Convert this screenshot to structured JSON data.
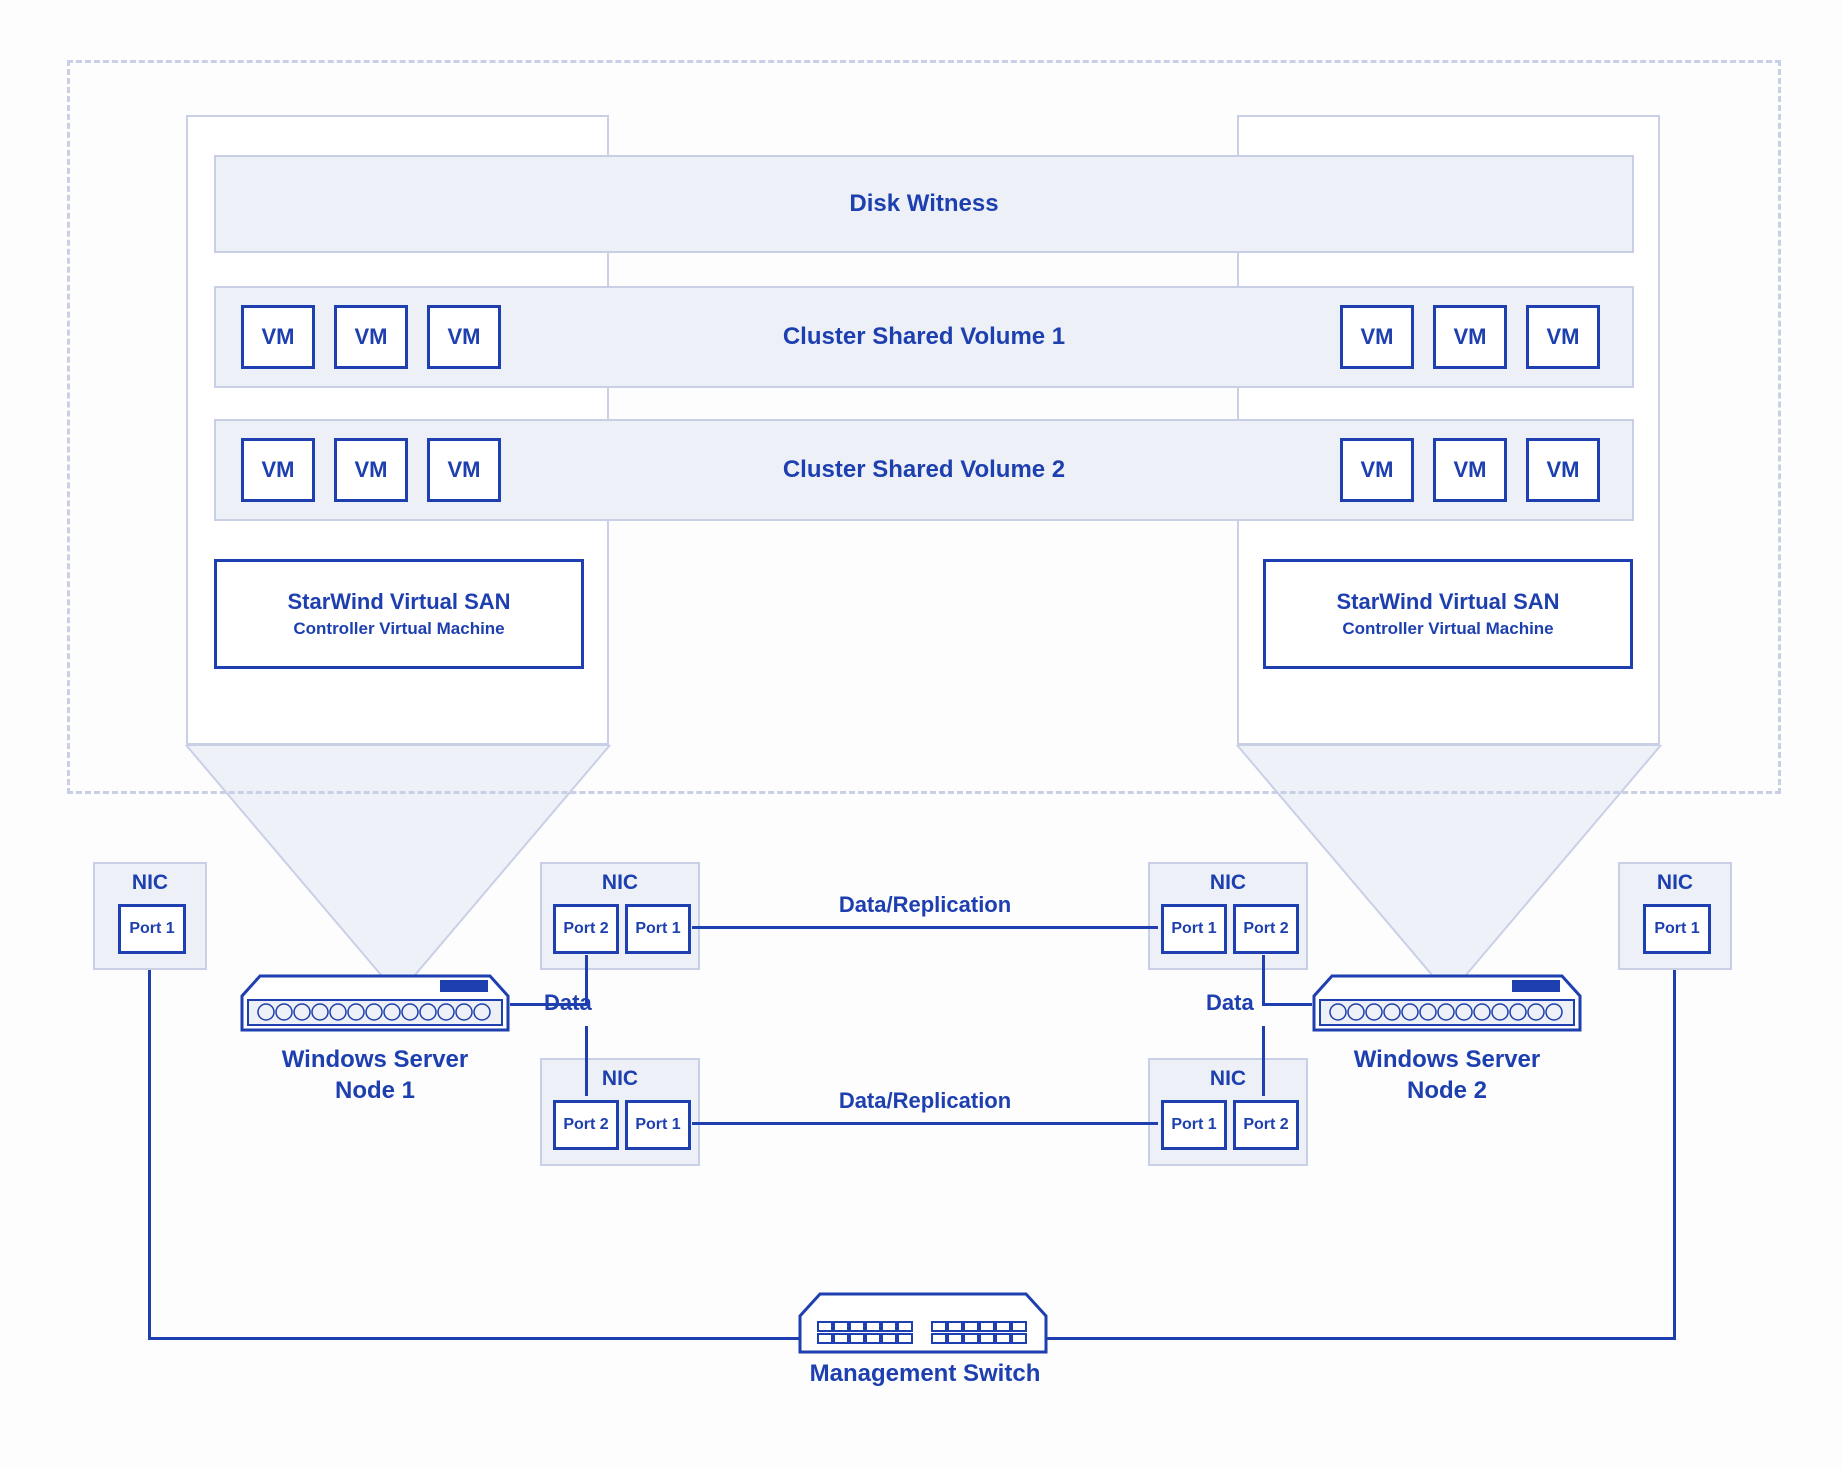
{
  "cluster": {
    "disk_witness": "Disk Witness",
    "csv1": "Cluster Shared Volume 1",
    "csv2": "Cluster Shared Volume 2",
    "vm_label": "VM",
    "vsan": {
      "title": "StarWind Virtual SAN",
      "sub": "Controller Virtual Machine"
    }
  },
  "nic_label": "NIC",
  "port1": "Port 1",
  "port2": "Port 2",
  "data_label": "Data",
  "replication_label": "Data/Replication",
  "servers": {
    "node1": "Windows Server\nNode 1",
    "node2": "Windows Server\nNode 2"
  },
  "switch_label": "Management Switch"
}
